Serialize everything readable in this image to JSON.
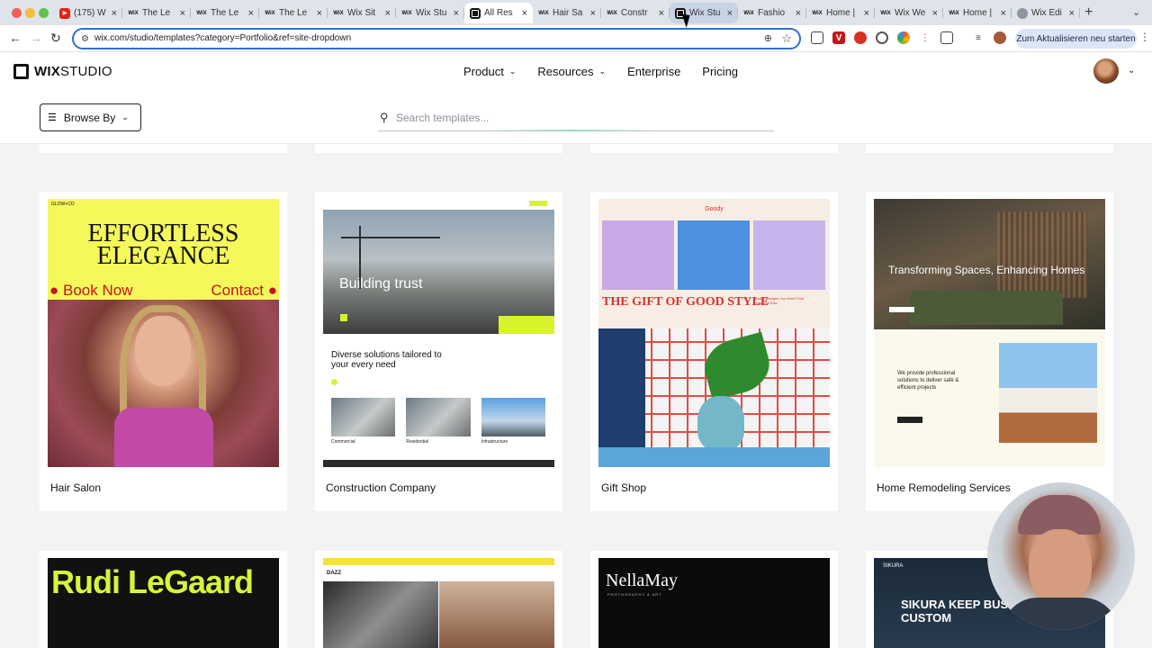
{
  "browser": {
    "tabs": [
      {
        "favicon": "youtube-icon",
        "title": "(175) W"
      },
      {
        "favicon": "wix-icon",
        "title": "The Le"
      },
      {
        "favicon": "wix-icon",
        "title": "The Le"
      },
      {
        "favicon": "wix-icon",
        "title": "The Le"
      },
      {
        "favicon": "wix-icon",
        "title": "Wix Sit"
      },
      {
        "favicon": "wix-icon",
        "title": "Wix Stu"
      },
      {
        "favicon": "wix-studio-icon",
        "title": "All Res",
        "active": true
      },
      {
        "favicon": "wix-icon",
        "title": "Hair Sa"
      },
      {
        "favicon": "wix-icon",
        "title": "Constr"
      },
      {
        "favicon": "wix-studio-icon",
        "title": "Wix Stu",
        "hover": true
      },
      {
        "favicon": "wix-icon",
        "title": "Fashio"
      },
      {
        "favicon": "wix-icon",
        "title": "Home |"
      },
      {
        "favicon": "wix-icon",
        "title": "Wix We"
      },
      {
        "favicon": "wix-icon",
        "title": "Home |"
      },
      {
        "favicon": "globe-icon",
        "title": "Wix Edi"
      }
    ],
    "new_tab_label": "+",
    "url": "wix.com/studio/templates?category=Portfolio&ref=site-dropdown",
    "update_button_label": "Zum Aktualisieren neu starten"
  },
  "site": {
    "logo_bold": "WIX",
    "logo_light": "STUDIO",
    "nav": [
      {
        "label": "Product",
        "has_dropdown": true
      },
      {
        "label": "Resources",
        "has_dropdown": true
      },
      {
        "label": "Enterprise",
        "has_dropdown": false
      },
      {
        "label": "Pricing",
        "has_dropdown": false
      }
    ]
  },
  "filters": {
    "browse_label": "Browse By",
    "search_placeholder": "Search templates..."
  },
  "templates": [
    {
      "name": "Hair Salon",
      "preview": {
        "brand": "GLOW+CO",
        "headline_1": "EFFORTLESS",
        "headline_2": "ELEGANCE",
        "cta_left": "Book Now",
        "cta_right": "Contact"
      }
    },
    {
      "name": "Construction Company",
      "preview": {
        "headline": "Building trust",
        "section_heading": "Diverse solutions tailored to your every need",
        "captions": [
          "Commercial",
          "Residential",
          "Infrastructure"
        ]
      }
    },
    {
      "name": "Gift Shop",
      "preview": {
        "brand": "Goody",
        "headline": "THE GIFT OF GOOD STYLE",
        "blurb": "Unique Designs You Won't Find Anywhere Else"
      }
    },
    {
      "name": "Home Remodeling Services",
      "preview": {
        "headline": "Transforming Spaces, Enhancing Homes",
        "about": "We provide professional solutions to deliver safe & efficient projects"
      }
    }
  ],
  "templates_row2": [
    {
      "preview_title": "Rudi LeGaard"
    },
    {
      "preview_title": "DAZZ"
    },
    {
      "preview_title": "NellaMay",
      "preview_tag": "PHOTOGRAPHY & ART"
    },
    {
      "preview_title": "SIKURA",
      "preview_headline": "SIKURA KEEP BUSINESS & CUSTOM"
    }
  ],
  "colors": {
    "accent_blue": "#2f6fd6",
    "hair_salon_yellow": "#f4f85a",
    "construction_lime": "#d8f32b",
    "gift_red": "#d8332e"
  }
}
